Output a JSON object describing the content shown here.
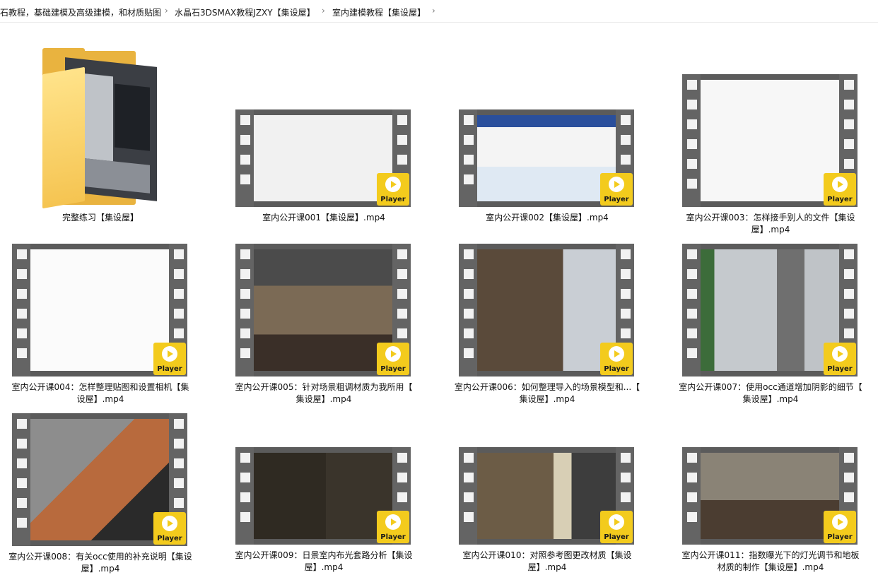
{
  "breadcrumb": {
    "items": [
      "石教程，基础建模及高级建模，和材质贴图",
      "水晶石3DSMAX教程JZXY【集设屋】",
      "室内建模教程【集设屋】"
    ],
    "separator": "›"
  },
  "player_label": "Player",
  "items": [
    {
      "name": "完整练习【集设屋】",
      "type": "folder"
    },
    {
      "name": "室内公开课001【集设屋】.mp4",
      "type": "video",
      "line1": "室内公开课001【集设屋】.mp4",
      "line2": ""
    },
    {
      "name": "室内公开课002【集设屋】.mp4",
      "type": "video",
      "line1": "室内公开课002【集设屋】.mp4",
      "line2": ""
    },
    {
      "name": "室内公开课003：怎样接手别人的文件【集设屋】.mp4",
      "type": "video",
      "line1": "室内公开课003：怎样接手别人的文件【集设",
      "line2": "屋】.mp4"
    },
    {
      "name": "室内公开课004：怎样整理贴图和设置相机【集设屋】.mp4",
      "type": "video",
      "line1": "室内公开课004：怎样整理贴图和设置相机【集",
      "line2": "设屋】.mp4"
    },
    {
      "name": "室内公开课005：针对场景粗调材质为我所用【集设屋】.mp4",
      "type": "video",
      "line1": "室内公开课005：针对场景粗调材质为我所用【",
      "line2": "集设屋】.mp4"
    },
    {
      "name": "室内公开课006：如何整理导入的场景模型和...【集设屋】.mp4",
      "type": "video",
      "line1": "室内公开课006：如何整理导入的场景模型和...【",
      "line2": "集设屋】.mp4"
    },
    {
      "name": "室内公开课007：使用occ通道增加阴影的细节【集设屋】.mp4",
      "type": "video",
      "line1": "室内公开课007：使用occ通道增加阴影的细节【",
      "line2": "集设屋】.mp4"
    },
    {
      "name": "室内公开课008：有关occ使用的补充说明【集设屋】.mp4",
      "type": "video",
      "line1": "室内公开课008：有关occ使用的补充说明【集设",
      "line2": "屋】.mp4"
    },
    {
      "name": "室内公开课009：日景室内布光套路分析【集设屋】.mp4",
      "type": "video",
      "line1": "室内公开课009：日景室内布光套路分析【集设",
      "line2": "屋】.mp4"
    },
    {
      "name": "室内公开课010：对照参考图更改材质【集设屋】.mp4",
      "type": "video",
      "line1": "室内公开课010：对照参考图更改材质【集设",
      "line2": "屋】.mp4"
    },
    {
      "name": "室内公开课011：指数曝光下的灯光调节和地板材质的制作【集设屋】.mp4",
      "type": "video",
      "line1": "室内公开课011：指数曝光下的灯光调节和地板",
      "line2": "材质的制作【集设屋】.mp4"
    }
  ],
  "colors": {
    "player_yellow": "#f3cb1d",
    "film_gray": "#5b5b5b",
    "folder_yellow": "#f5c451"
  }
}
